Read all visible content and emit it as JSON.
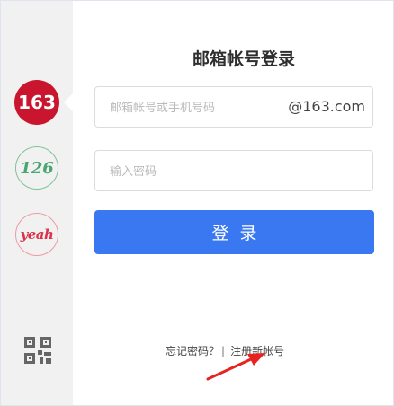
{
  "sidebar": {
    "logos": [
      {
        "label": "163",
        "selected": true
      },
      {
        "label": "126",
        "selected": false
      },
      {
        "label": "yeah",
        "selected": false
      }
    ],
    "qr_icon": "qr-code-icon"
  },
  "form": {
    "title": "邮箱帐号登录",
    "account_placeholder": "邮箱帐号或手机号码",
    "account_suffix": "@163.com",
    "password_placeholder": "输入密码",
    "login_label": "登录"
  },
  "footer": {
    "forgot_password": "忘记密码？",
    "separator": "|",
    "register": "注册新帐号"
  },
  "colors": {
    "accent": "#3a78f2",
    "brand_163": "#c9152e",
    "brand_126": "#4aa771",
    "brand_yeah": "#d7364a",
    "annotation_arrow": "#e8231f"
  }
}
